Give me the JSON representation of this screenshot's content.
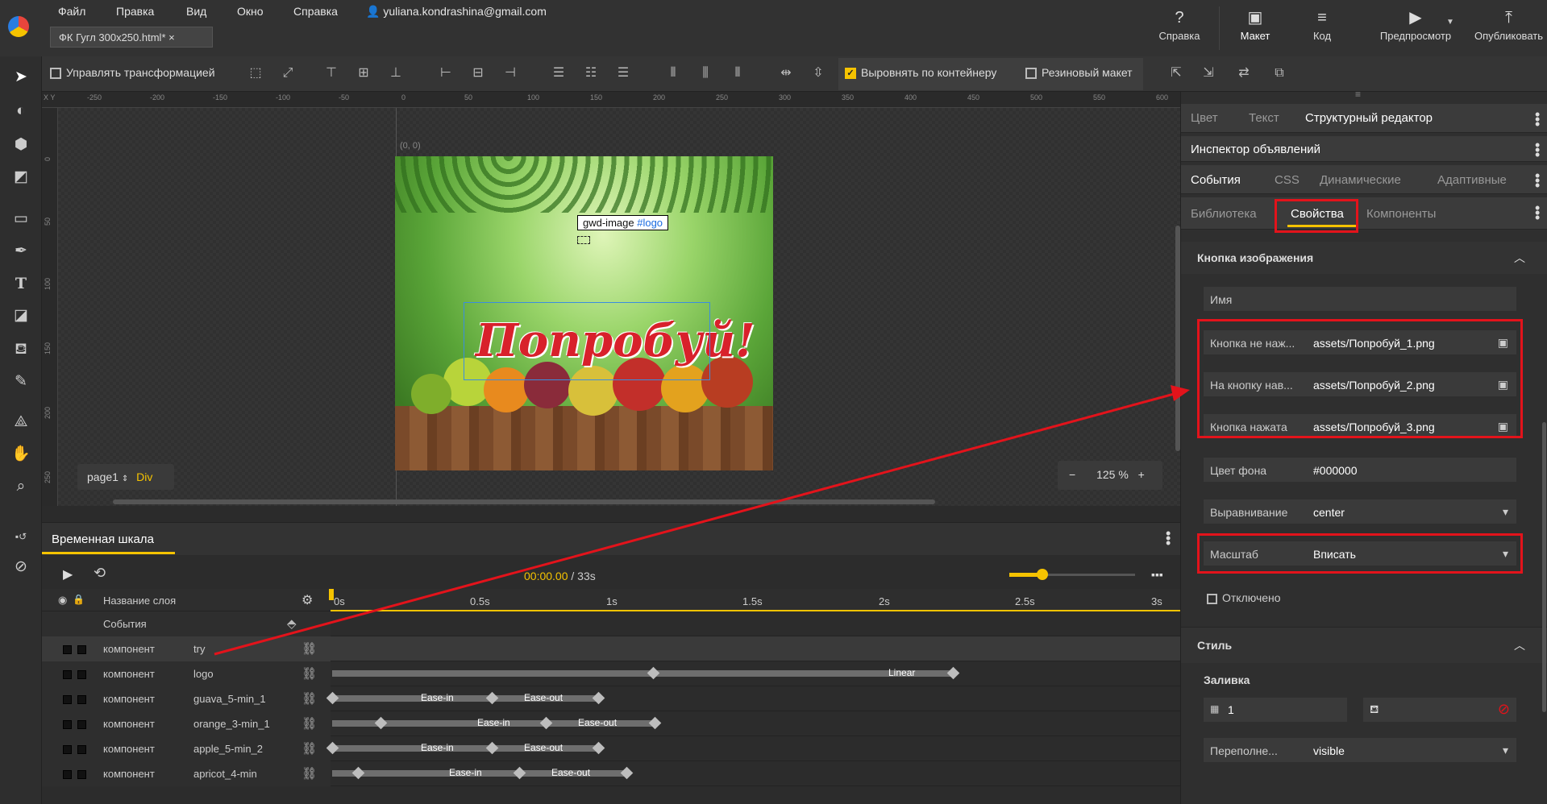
{
  "menu": [
    "Файл",
    "Правка",
    "Вид",
    "Окно",
    "Справка"
  ],
  "user_email": "yuliana.kondrashina@gmail.com",
  "doc_tab": "ФК Гугл 300x250.html*",
  "top_buttons": [
    "Справка",
    "Макет",
    "Код",
    "Предпросмотр",
    "Опубликовать"
  ],
  "toolbar": {
    "manage_transform": "Управлять трансформацией",
    "align_container": "Выровнять по контейнеру",
    "rubber_layout": "Резиновый макет"
  },
  "ruler_top": [
    "-250",
    "-200",
    "-150",
    "-100",
    "-50",
    "0",
    "50",
    "100",
    "150",
    "200",
    "250",
    "300",
    "350",
    "400",
    "450",
    "500",
    "550",
    "600"
  ],
  "ruler_left": [
    "0",
    "50",
    "100",
    "150",
    "200",
    "250"
  ],
  "stage": {
    "xy": "X Y",
    "origin": "(0, 0)",
    "logo_tag": "gwd-image",
    "logo_id": "#logo",
    "try_text": "Попробуй!",
    "page": "page1",
    "element": "Div",
    "zoom": "125",
    "zoom_unit": "%"
  },
  "timeline": {
    "title": "Временная шкала",
    "time_current": "00:00.00",
    "time_total": "/ 33s",
    "layer_name_header": "Название слоя",
    "events": "События",
    "ticks": [
      "0s",
      "0.5s",
      "1s",
      "1.5s",
      "2s",
      "2.5s",
      "3s"
    ],
    "rows": [
      {
        "kind": "компонент",
        "name": "try"
      },
      {
        "kind": "компонент",
        "name": "logo",
        "ease": [
          "Linear"
        ]
      },
      {
        "kind": "компонент",
        "name": "guava_5-min_1",
        "ease": [
          "Ease-in",
          "Ease-out"
        ]
      },
      {
        "kind": "компонент",
        "name": "orange_3-min_1",
        "ease": [
          "Ease-in",
          "Ease-out"
        ]
      },
      {
        "kind": "компонент",
        "name": "apple_5-min_2",
        "ease": [
          "Ease-in",
          "Ease-out"
        ]
      },
      {
        "kind": "компонент",
        "name": "apricot_4-min",
        "ease": [
          "Ease-in",
          "Ease-out"
        ]
      }
    ]
  },
  "panel": {
    "tabs1": [
      "Цвет",
      "Текст",
      "Структурный редактор"
    ],
    "ad_inspector": "Инспектор объявлений",
    "tabs2": [
      "События",
      "CSS",
      "Динамические",
      "Адаптивные"
    ],
    "tabs3": [
      "Библиотека",
      "Свойства",
      "Компоненты"
    ],
    "section_title": "Кнопка изображения",
    "name_label": "Имя",
    "img_up_label": "Кнопка не наж...",
    "img_up_value": "assets/Попробуй_1.png",
    "img_over_label": "На кнопку нав...",
    "img_over_value": "assets/Попробуй_2.png",
    "img_down_label": "Кнопка нажата",
    "img_down_value": "assets/Попробуй_3.png",
    "bg_label": "Цвет фона",
    "bg_value": "#000000",
    "align_label": "Выравнивание",
    "align_value": "center",
    "scale_label": "Масштаб",
    "scale_value": "Вписать",
    "disabled_label": "Отключено",
    "style_title": "Стиль",
    "fill_title": "Заливка",
    "fill_value": "1",
    "overflow_label": "Переполне...",
    "overflow_value": "visible"
  },
  "colors": {
    "accent": "#f5c300",
    "highlight_red": "#e3131b",
    "selection_blue": "#3a8de0"
  }
}
